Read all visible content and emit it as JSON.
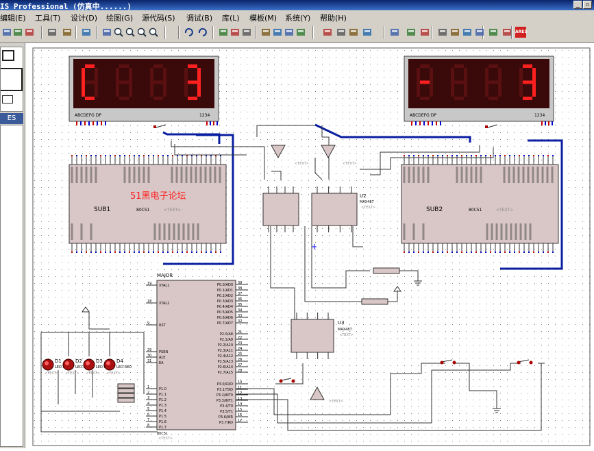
{
  "window": {
    "title": "IS Professional (仿真中......)",
    "min_btn": "_",
    "restore_btn": "▫"
  },
  "menu": [
    "编辑(E)",
    "工具(T)",
    "设计(D)",
    "绘图(G)",
    "源代码(S)",
    "调试(B)",
    "库(L)",
    "模板(M)",
    "系统(Y)",
    "帮助(H)"
  ],
  "toolbar": {
    "icons": [
      "save-icon",
      "print-icon",
      "print-setup-icon",
      "refresh-icon",
      "grid-icon",
      "origin-icon",
      "pan-icon",
      "zoom-in-icon",
      "zoom-out-icon",
      "zoom-all-icon",
      "zoom-area-icon",
      "undo-icon",
      "redo-icon",
      "cut-icon",
      "copy-icon",
      "paste-icon",
      "block-copy-icon",
      "block-move-icon",
      "block-rotate-icon",
      "block-delete-icon",
      "pick-device-icon",
      "make-device-icon",
      "packaging-tool-icon",
      "decompose-icon",
      "wire-autorouter-icon",
      "search-icon",
      "property-assign-icon",
      "design-explorer-icon",
      "new-sheet-icon",
      "remove-sheet-icon",
      "exit-to-parent-icon",
      "bill-of-materials-icon",
      "electrical-rule-check-icon",
      "netlist-to-ares-icon"
    ],
    "ares_label": "ARES"
  },
  "left_panel": {
    "mode_label": "ES"
  },
  "schematic": {
    "display_left": {
      "digits": [
        "C",
        "",
        "",
        "3"
      ],
      "pins_label": "ABCDEFG DP",
      "digits_label": "1234"
    },
    "display_right": {
      "digits": [
        "-",
        "",
        "",
        "3"
      ],
      "pins_label": "ABCDEFG DP",
      "digits_label": "1234"
    },
    "sub1": {
      "name": "SUB1",
      "part": "80C51",
      "watermark": "51黑电子论坛",
      "text_tag": "<TEXT>"
    },
    "sub2": {
      "name": "SUB2",
      "part": "80C51",
      "text_tag": "<TEXT>"
    },
    "u2": {
      "ref": "U2",
      "part": "MAX487",
      "text_tag": "<TEXT>"
    },
    "u3": {
      "ref": "U3",
      "part": "MAX487",
      "text_tag": "<TEXT>"
    },
    "major": {
      "name": "MAJOR",
      "part": "80C51",
      "text_tag": "<TEXT>",
      "left_pins": [
        {
          "num": "19",
          "name": "XTAL1"
        },
        {
          "num": "18",
          "name": "XTAL2"
        },
        {
          "num": "9",
          "name": "RST"
        },
        {
          "num": "29",
          "name": "PSEN"
        },
        {
          "num": "30",
          "name": "ALE"
        },
        {
          "num": "31",
          "name": "EA"
        },
        {
          "num": "1",
          "name": "P1.0"
        },
        {
          "num": "2",
          "name": "P1.1"
        },
        {
          "num": "3",
          "name": "P1.2"
        },
        {
          "num": "4",
          "name": "P1.3"
        },
        {
          "num": "5",
          "name": "P1.4"
        },
        {
          "num": "6",
          "name": "P1.5"
        },
        {
          "num": "7",
          "name": "P1.6"
        },
        {
          "num": "8",
          "name": "P1.7"
        }
      ],
      "right_pins": [
        {
          "num": "39",
          "name": "P0.0/AD0"
        },
        {
          "num": "38",
          "name": "P0.1/AD1"
        },
        {
          "num": "37",
          "name": "P0.2/AD2"
        },
        {
          "num": "36",
          "name": "P0.3/AD3"
        },
        {
          "num": "35",
          "name": "P0.4/AD4"
        },
        {
          "num": "34",
          "name": "P0.5/AD5"
        },
        {
          "num": "33",
          "name": "P0.6/AD6"
        },
        {
          "num": "32",
          "name": "P0.7/AD7"
        },
        {
          "num": "21",
          "name": "P2.0/A8"
        },
        {
          "num": "22",
          "name": "P2.1/A9"
        },
        {
          "num": "23",
          "name": "P2.2/A10"
        },
        {
          "num": "24",
          "name": "P2.3/A11"
        },
        {
          "num": "25",
          "name": "P2.4/A12"
        },
        {
          "num": "26",
          "name": "P2.5/A13"
        },
        {
          "num": "27",
          "name": "P2.6/A14"
        },
        {
          "num": "28",
          "name": "P2.7/A15"
        },
        {
          "num": "10",
          "name": "P3.0/RXD"
        },
        {
          "num": "11",
          "name": "P3.1/TXD"
        },
        {
          "num": "12",
          "name": "P3.2/INT0"
        },
        {
          "num": "13",
          "name": "P3.3/INT1"
        },
        {
          "num": "14",
          "name": "P3.4/T0"
        },
        {
          "num": "15",
          "name": "P3.5/T1"
        },
        {
          "num": "16",
          "name": "P3.6/WR"
        },
        {
          "num": "17",
          "name": "P3.7/RD"
        }
      ]
    },
    "leds": [
      {
        "ref": "D1",
        "part": "LED-RED"
      },
      {
        "ref": "D2",
        "part": "LED-RED"
      },
      {
        "ref": "D3",
        "part": "LED-RED"
      },
      {
        "ref": "D4",
        "part": "LED-RED"
      }
    ],
    "text_tag": "<TEXT>"
  },
  "colors": {
    "bus": "#0a1ea0",
    "component_fill": "#d9c6c6",
    "pin_red": "#cc0000",
    "pin_blue": "#0000cc",
    "segment_on": "#ff2020",
    "segment_off": "#5a1010",
    "display_bg": "#3a0a0a",
    "watermark": "#ff2020"
  }
}
